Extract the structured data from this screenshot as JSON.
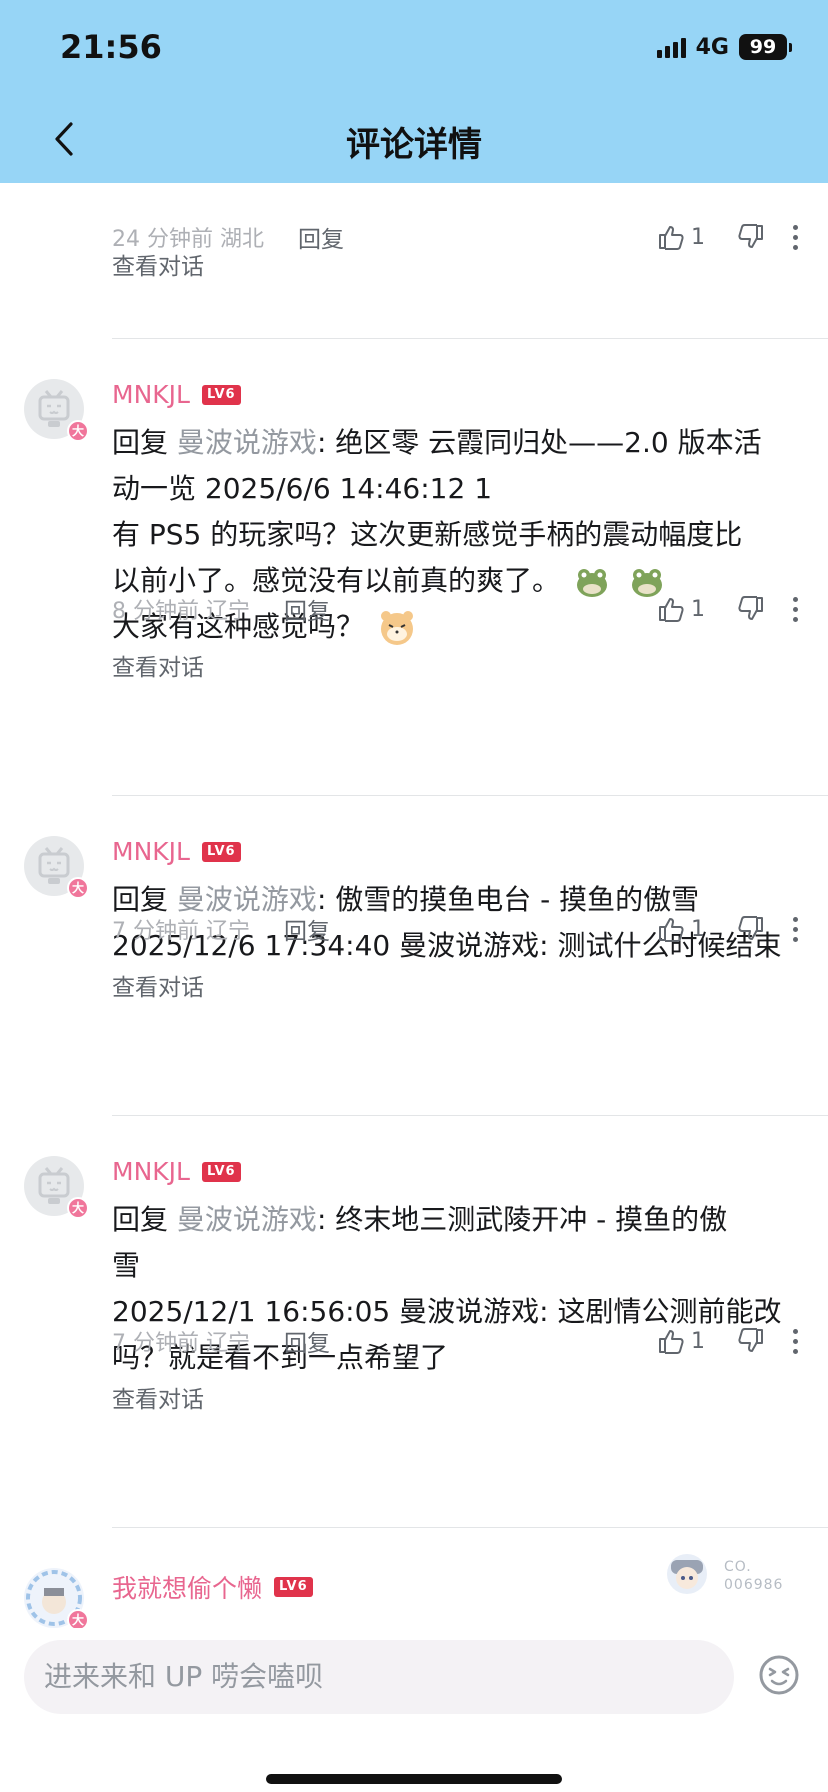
{
  "status_bar": {
    "time": "21:56",
    "network": "4G",
    "battery": "99"
  },
  "header": {
    "title": "评论详情"
  },
  "top_item": {
    "time": "24 分钟前",
    "location": "湖北",
    "reply_label": "回复",
    "likes": "1",
    "view_conversation": "查看对话"
  },
  "comments": [
    {
      "username": "MNKJL",
      "level": "LV6",
      "badge": "大",
      "reply_prefix": "回复",
      "quoted_user": "曼波说游戏",
      "line1": ": 绝区零 云霞同归处——2.0 版本活",
      "line2": "动一览 2025/6/6 14:46:12 1",
      "line3": "有 PS5 的玩家吗？这次更新感觉手柄的震动幅度比",
      "line4": "以前小了。感觉没有以前真的爽了。",
      "line5": "大家有这种感觉吗？",
      "time": "8 分钟前",
      "location": "辽宁",
      "reply_label": "回复",
      "likes": "1",
      "view_conversation": "查看对话"
    },
    {
      "username": "MNKJL",
      "level": "LV6",
      "badge": "大",
      "reply_prefix": "回复",
      "quoted_user": "曼波说游戏",
      "line1": ": 傲雪的摸鱼电台 - 摸鱼的傲雪",
      "line2": "2025/12/6 17:34:40 曼波说游戏: 测试什么时候结束",
      "time": "7 分钟前",
      "location": "辽宁",
      "reply_label": "回复",
      "likes": "1",
      "view_conversation": "查看对话"
    },
    {
      "username": "MNKJL",
      "level": "LV6",
      "badge": "大",
      "reply_prefix": "回复",
      "quoted_user": "曼波说游戏",
      "line1": ": 终末地三测武陵开冲 - 摸鱼的傲",
      "line2": "雪",
      "line3": "2025/12/1 16:56:05 曼波说游戏: 这剧情公测前能改",
      "line4": "吗？就是看不到一点希望了",
      "time": "7 分钟前",
      "location": "辽宁",
      "reply_label": "回复",
      "likes": "1",
      "view_conversation": "查看对话"
    },
    {
      "username": "我就想偷个懒",
      "level": "LV6",
      "badge": "大",
      "sticker_line1": "CO.",
      "sticker_line2": "006986"
    }
  ],
  "footer": {
    "input_placeholder": "进来来和 UP 唠会嗑呗"
  },
  "colors": {
    "header_bg": "#97d5f6",
    "username": "#e8668f",
    "level_badge": "#e0334b",
    "quoted": "#9499a0"
  }
}
